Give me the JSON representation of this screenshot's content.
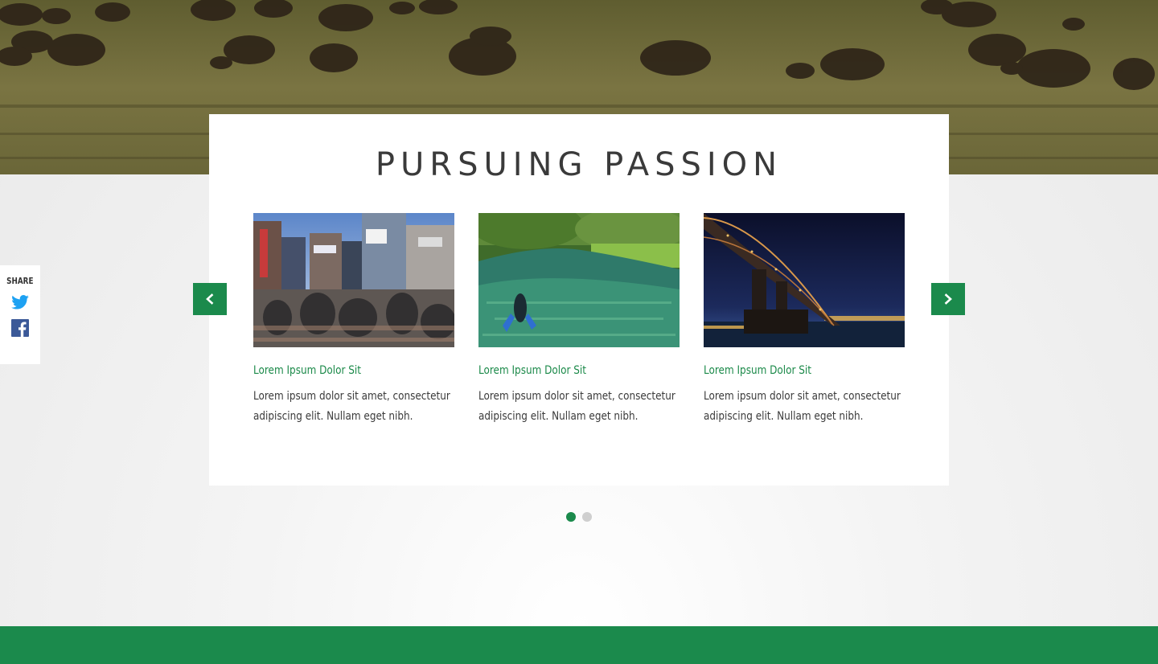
{
  "hero": {
    "icon": "bison-prairie-image"
  },
  "section": {
    "title": "PURSUING PASSION"
  },
  "carousel": {
    "items": [
      {
        "title": "Lorem Ipsum Dolor Sit",
        "text": "Lorem ipsum dolor sit amet, consectetur adipiscing elit. Nullam eget nibh.",
        "image": "city-crosswalk-image"
      },
      {
        "title": "Lorem Ipsum Dolor Sit",
        "text": "Lorem ipsum dolor sit amet, consectetur adipiscing elit. Nullam eget nibh.",
        "image": "river-snorkeler-image"
      },
      {
        "title": "Lorem Ipsum Dolor Sit",
        "text": "Lorem ipsum dolor sit amet, consectetur adipiscing elit. Nullam eget nibh.",
        "image": "night-bridge-image"
      }
    ],
    "prev_icon": "chevron-left-icon",
    "next_icon": "chevron-right-icon",
    "pages": 2,
    "active_page": 1
  },
  "share": {
    "label": "SHARE",
    "icons": [
      "twitter-icon",
      "facebook-icon"
    ]
  },
  "colors": {
    "accent": "#1b8a4c",
    "twitter": "#1da1f2",
    "facebook": "#3b5998"
  }
}
